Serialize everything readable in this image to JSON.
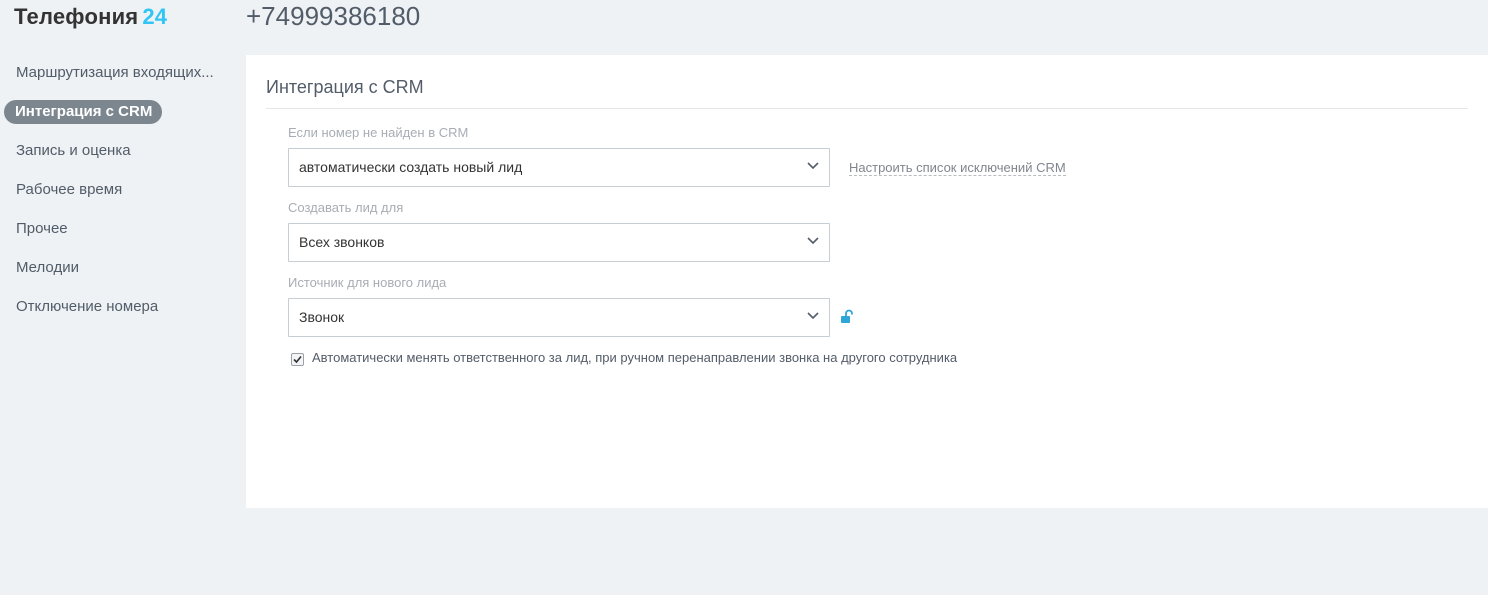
{
  "header": {
    "brand_name": "Телефония",
    "brand_number": "24",
    "phone_number": "+74999386180"
  },
  "sidebar": {
    "items": [
      {
        "label": "Маршрутизация входящих..."
      },
      {
        "label": "Интеграция с CRM",
        "active": true
      },
      {
        "label": "Запись и оценка"
      },
      {
        "label": "Рабочее время"
      },
      {
        "label": "Прочее"
      },
      {
        "label": "Мелодии"
      },
      {
        "label": "Отключение номера"
      }
    ]
  },
  "main": {
    "title": "Интеграция с CRM",
    "fields": [
      {
        "label": "Если номер не найден в CRM",
        "value": "автоматически создать новый лид"
      },
      {
        "label": "Создавать лид для",
        "value": "Всех звонков"
      },
      {
        "label": "Источник для нового лида",
        "value": "Звонок"
      }
    ],
    "exceptions_link": "Настроить список исключений CRM",
    "auto_change_checkbox": {
      "checked": true,
      "label": "Автоматически менять ответственного за лид, при ручном перенаправлении звонка на другого сотрудника"
    }
  },
  "icons": {
    "dropdown": "chevron-down-icon",
    "lock": "unlock-icon"
  },
  "colors": {
    "brand_accent": "#2fc6f6",
    "active_nav_bg": "#7c868f",
    "page_bg": "#eef2f4",
    "panel_bg": "#ffffff"
  }
}
